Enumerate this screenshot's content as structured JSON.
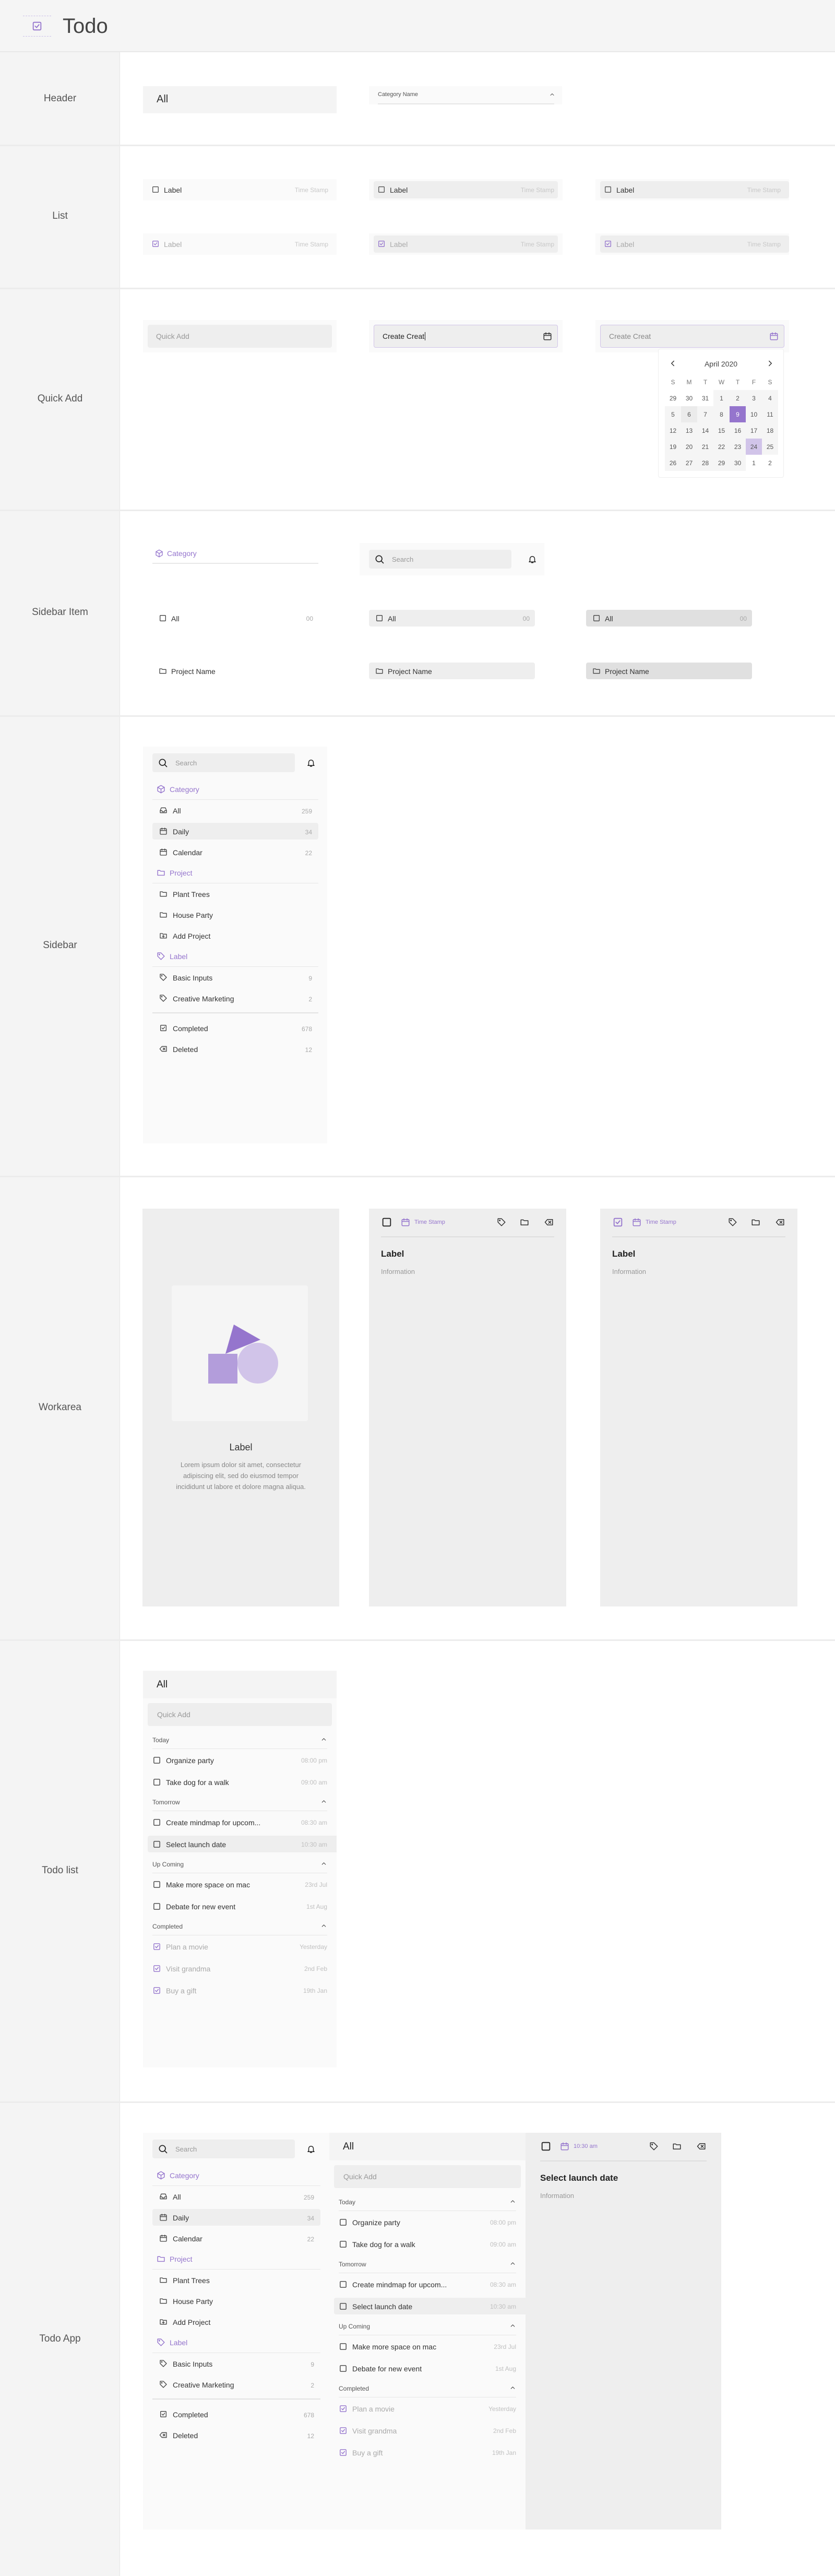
{
  "app": {
    "title": "Todo"
  },
  "colors": {
    "accent": "#9575cd",
    "accent_light": "#d1c4e9",
    "panel": "#fafafa",
    "input": "#eeeeee",
    "text": "#333333"
  },
  "sections": [
    "Header",
    "List",
    "Quick Add",
    "Sidebar Item",
    "Sidebar",
    "Workarea",
    "Todo list",
    "Todo App"
  ],
  "header_section": {
    "title": "All",
    "dropdown_label": "Category Name",
    "dropdown_icon": "chevron-up-icon"
  },
  "list_section": {
    "rows": [
      {
        "label": "Label",
        "timestamp": "Time Stamp",
        "checked": false
      },
      {
        "label": "Label",
        "timestamp": "Time Stamp",
        "checked": true
      }
    ]
  },
  "quick_add": {
    "placeholder": "Quick Add",
    "typed_value": "Create Creat",
    "filled_value": "Create Creat",
    "calendar": {
      "month": "April 2020",
      "weekdays": [
        "S",
        "M",
        "T",
        "W",
        "T",
        "F",
        "S"
      ],
      "weeks": [
        [
          "29",
          "30",
          "31",
          "1",
          "2",
          "3",
          "4"
        ],
        [
          "5",
          "6",
          "7",
          "8",
          "9",
          "10",
          "11"
        ],
        [
          "12",
          "13",
          "14",
          "15",
          "16",
          "17",
          "18"
        ],
        [
          "19",
          "20",
          "21",
          "22",
          "23",
          "24",
          "25"
        ],
        [
          "26",
          "27",
          "28",
          "29",
          "30",
          "1",
          "2"
        ]
      ],
      "today": "6",
      "selected": "9",
      "highlighted": "24"
    }
  },
  "sidebar_item": {
    "category": "Category",
    "search_placeholder": "Search",
    "all_label": "All",
    "all_count": "00",
    "project_label": "Project Name"
  },
  "sidebar": {
    "search_placeholder": "Search",
    "groups": [
      {
        "heading": "Category",
        "icon": "cube-icon",
        "items": [
          {
            "label": "All",
            "count": "259",
            "icon": "inbox-icon"
          },
          {
            "label": "Daily",
            "count": "34",
            "icon": "calendar-icon",
            "active": true
          },
          {
            "label": "Calendar",
            "count": "22",
            "icon": "calendar-icon"
          }
        ]
      },
      {
        "heading": "Project",
        "icon": "folder-icon",
        "items": [
          {
            "label": "Plant Trees",
            "icon": "folder-icon"
          },
          {
            "label": "House Party",
            "icon": "folder-icon"
          },
          {
            "label": "Add Project",
            "icon": "folder-plus-icon"
          }
        ]
      },
      {
        "heading": "Label",
        "icon": "tag-icon",
        "items": [
          {
            "label": "Basic Inputs",
            "count": "9",
            "icon": "tag-icon"
          },
          {
            "label": "Creative Marketing",
            "count": "2",
            "icon": "tag-icon"
          }
        ]
      }
    ],
    "footer": [
      {
        "label": "Completed",
        "count": "678",
        "icon": "check-square-icon"
      },
      {
        "label": "Deleted",
        "count": "12",
        "icon": "backspace-icon"
      }
    ]
  },
  "workarea": {
    "empty": {
      "title": "Label",
      "text": "Lorem ipsum dolor sit amet, consectetur adipiscing elit, sed do eiusmod tempor incididunt ut labore et dolore magna aliqua."
    },
    "detail": {
      "timestamp": "Time Stamp",
      "title": "Label",
      "info": "Information"
    }
  },
  "todo_list": {
    "title": "All",
    "quick_add_placeholder": "Quick Add",
    "groups": [
      {
        "name": "Today",
        "items": [
          {
            "label": "Organize party",
            "time": "08:00 pm"
          },
          {
            "label": "Take dog for a walk",
            "time": "09:00 am"
          }
        ]
      },
      {
        "name": "Tomorrow",
        "items": [
          {
            "label": "Create mindmap for upcom...",
            "time": "08:30 am"
          },
          {
            "label": "Select launch date",
            "time": "10:30 am",
            "active": true
          }
        ]
      },
      {
        "name": "Up Coming",
        "items": [
          {
            "label": "Make more space on mac",
            "time": "23rd Jul"
          },
          {
            "label": "Debate for new event",
            "time": "1st Aug"
          }
        ]
      },
      {
        "name": "Completed",
        "items": [
          {
            "label": "Plan a movie",
            "time": "Yesterday",
            "done": true
          },
          {
            "label": "Visit grandma",
            "time": "2nd Feb",
            "done": true
          },
          {
            "label": "Buy a gift",
            "time": "19th Jan",
            "done": true
          }
        ]
      }
    ]
  },
  "todo_app": {
    "timestamp": "10:30 am",
    "title": "Select launch date",
    "info": "Information"
  }
}
